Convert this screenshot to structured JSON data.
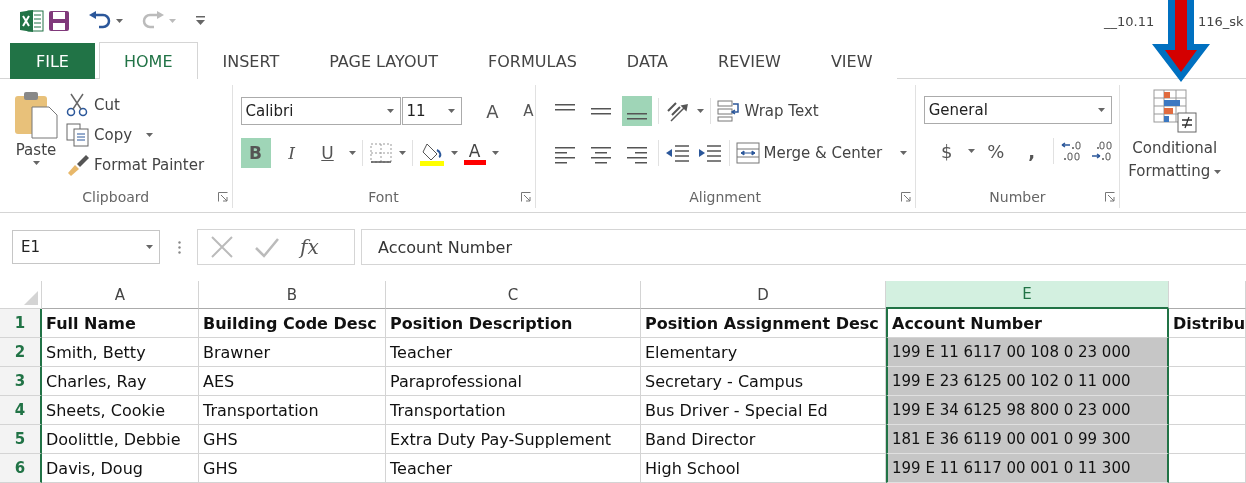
{
  "title_bar": {
    "title_start": "__10.11",
    "title_end": "116_sk"
  },
  "tabs": [
    {
      "label": "FILE",
      "kind": "file",
      "selected": false
    },
    {
      "label": "HOME",
      "kind": "tab",
      "selected": true
    },
    {
      "label": "INSERT",
      "kind": "tab",
      "selected": false
    },
    {
      "label": "PAGE LAYOUT",
      "kind": "tab",
      "selected": false
    },
    {
      "label": "FORMULAS",
      "kind": "tab",
      "selected": false
    },
    {
      "label": "DATA",
      "kind": "tab",
      "selected": false
    },
    {
      "label": "REVIEW",
      "kind": "tab",
      "selected": false
    },
    {
      "label": "VIEW",
      "kind": "tab",
      "selected": false
    }
  ],
  "clipboard": {
    "paste": "Paste",
    "cut": "Cut",
    "copy": "Copy",
    "format_painter": "Format Painter",
    "group_label": "Clipboard"
  },
  "font": {
    "name": "Calibri",
    "size": "11",
    "grow": "A",
    "shrink": "A",
    "styles": [
      {
        "label": "B",
        "kind": "bold",
        "on": true
      },
      {
        "label": "I",
        "kind": "italic",
        "on": false
      },
      {
        "label": "U",
        "kind": "underline",
        "on": false
      }
    ],
    "font_color": "A",
    "group_label": "Font"
  },
  "alignment": {
    "vertical": [
      {
        "kind": "top",
        "on": false
      },
      {
        "kind": "middle",
        "on": false
      },
      {
        "kind": "bottom",
        "on": true
      }
    ],
    "horizontal": [
      {
        "kind": "left",
        "on": false
      },
      {
        "kind": "center",
        "on": false
      },
      {
        "kind": "right",
        "on": false
      }
    ],
    "wrap_text": "Wrap Text",
    "merge_center": "Merge & Center",
    "group_label": "Alignment"
  },
  "number": {
    "format": "General",
    "currency": "$",
    "percent": "%",
    "comma": ",",
    "group_label": "Number"
  },
  "styles": {
    "conditional_formatting": [
      "Conditional",
      "Formatting"
    ]
  },
  "formula_bar": {
    "name_box": "E1",
    "fx": "fx",
    "formula": "Account Number"
  },
  "sheet": {
    "columns": [
      {
        "label": "A",
        "selected": false
      },
      {
        "label": "B",
        "selected": false
      },
      {
        "label": "C",
        "selected": false
      },
      {
        "label": "D",
        "selected": false
      },
      {
        "label": "E",
        "selected": true
      }
    ],
    "rows": [
      {
        "number": "1",
        "kind": "header",
        "cells": [
          "Full Name",
          "Building Code Desc",
          "Position Description",
          "Position Assignment Desc",
          "Account Number",
          "Distribu"
        ]
      },
      {
        "number": "2",
        "kind": "data",
        "cells": [
          "Smith, Betty",
          "Brawner",
          "Teacher",
          "Elementary",
          "199 E 11 6117 00 108 0 23 000"
        ]
      },
      {
        "number": "3",
        "kind": "data",
        "cells": [
          "Charles, Ray",
          "AES",
          "Paraprofessional",
          "Secretary - Campus",
          "199 E 23 6125 00 102 0 11 000"
        ]
      },
      {
        "number": "4",
        "kind": "data",
        "cells": [
          "Sheets, Cookie",
          "Transportation",
          "Transportation",
          "Bus Driver - Special Ed",
          "199 E 34 6125 98 800 0 23 000"
        ]
      },
      {
        "number": "5",
        "kind": "data",
        "cells": [
          "Doolittle, Debbie",
          "GHS",
          "Extra Duty Pay-Supplement",
          "Band Director",
          "181 E 36 6119 00 001 0 99 300"
        ]
      },
      {
        "number": "6",
        "kind": "data",
        "cells": [
          "Davis, Doug",
          "GHS",
          "Teacher",
          "High School",
          "199 E 11 6117 00 001 0 11 300"
        ]
      }
    ]
  }
}
